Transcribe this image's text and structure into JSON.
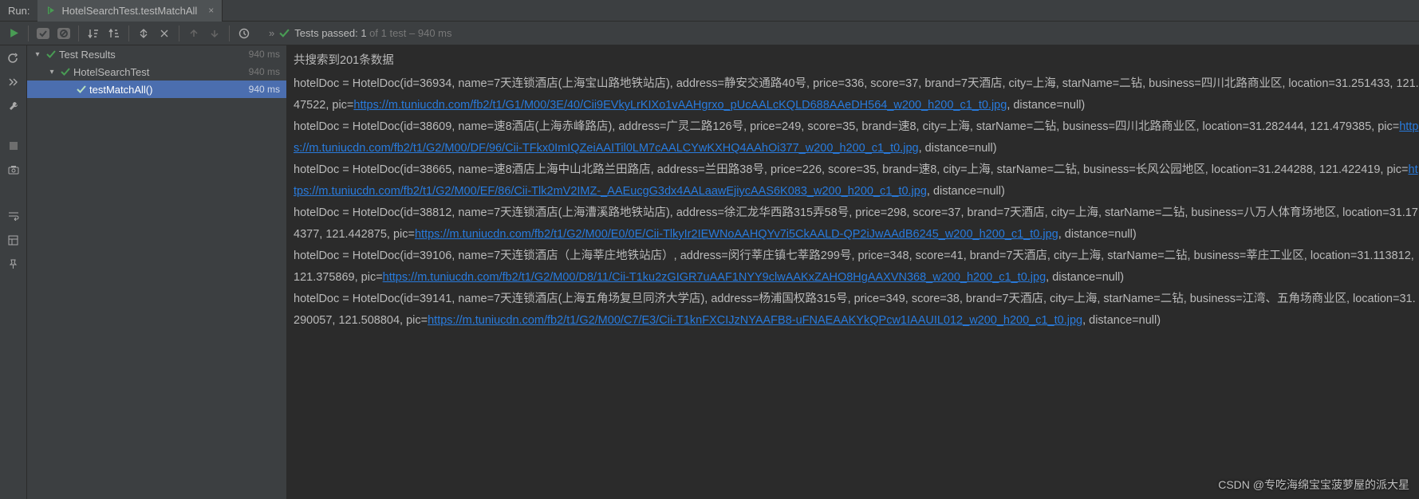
{
  "header": {
    "run_label": "Run:",
    "tab_title": "HotelSearchTest.testMatchAll"
  },
  "status": {
    "passed_prefix": "Tests passed: 1",
    "passed_suffix": " of 1 test – 940 ms"
  },
  "tree": {
    "nodes": [
      {
        "label": "Test Results",
        "time": "940 ms",
        "level": 0,
        "selected": false,
        "arrow": true
      },
      {
        "label": "HotelSearchTest",
        "time": "940 ms",
        "level": 1,
        "selected": false,
        "arrow": true
      },
      {
        "label": "testMatchAll()",
        "time": "940 ms",
        "level": 2,
        "selected": true,
        "arrow": false
      }
    ]
  },
  "console": {
    "summary": "共搜索到201条数据",
    "entries": [
      {
        "pre": "hotelDoc = HotelDoc(id=36934, name=7天连锁酒店(上海宝山路地铁站店), address=静安交通路40号, price=336, score=37, brand=7天酒店, city=上海, starName=二钻, business=四川北路商业区, location=31.251433, 121.47522, pic=",
        "link": "https://m.tuniucdn.com/fb2/t1/G1/M00/3E/40/Cii9EVkyLrKIXo1vAAHgrxo_pUcAALcKQLD688AAeDH564_w200_h200_c1_t0.jpg",
        "post": ", distance=null)"
      },
      {
        "pre": "hotelDoc = HotelDoc(id=38609, name=速8酒店(上海赤峰路店), address=广灵二路126号, price=249, score=35, brand=速8, city=上海, starName=二钻, business=四川北路商业区, location=31.282444, 121.479385, pic=",
        "link": "https://m.tuniucdn.com/fb2/t1/G2/M00/DF/96/Cii-TFkx0ImIQZeiAAITil0LM7cAALCYwKXHQ4AAhOi377_w200_h200_c1_t0.jpg",
        "post": ", distance=null)"
      },
      {
        "pre": "hotelDoc = HotelDoc(id=38665, name=速8酒店上海中山北路兰田路店, address=兰田路38号, price=226, score=35, brand=速8, city=上海, starName=二钻, business=长风公园地区, location=31.244288, 121.422419, pic=",
        "link": "https://m.tuniucdn.com/fb2/t1/G2/M00/EF/86/Cii-Tlk2mV2IMZ-_AAEucgG3dx4AALaawEjiycAAS6K083_w200_h200_c1_t0.jpg",
        "post": ", distance=null)"
      },
      {
        "pre": "hotelDoc = HotelDoc(id=38812, name=7天连锁酒店(上海漕溪路地铁站店), address=徐汇龙华西路315弄58号, price=298, score=37, brand=7天酒店, city=上海, starName=二钻, business=八万人体育场地区, location=31.174377, 121.442875, pic=",
        "link": "https://m.tuniucdn.com/fb2/t1/G2/M00/E0/0E/Cii-TlkyIr2IEWNoAAHQYv7i5CkAALD-QP2iJwAAdB6245_w200_h200_c1_t0.jpg",
        "post": ", distance=null)"
      },
      {
        "pre": "hotelDoc = HotelDoc(id=39106, name=7天连锁酒店（上海莘庄地铁站店）, address=闵行莘庄镇七莘路299号, price=348, score=41, brand=7天酒店, city=上海, starName=二钻, business=莘庄工业区, location=31.113812, 121.375869, pic=",
        "link": "https://m.tuniucdn.com/fb2/t1/G2/M00/D8/11/Cii-T1ku2zGIGR7uAAF1NYY9clwAAKxZAHO8HgAAXVN368_w200_h200_c1_t0.jpg",
        "post": ", distance=null)"
      },
      {
        "pre": "hotelDoc = HotelDoc(id=39141, name=7天连锁酒店(上海五角场复旦同济大学店), address=杨浦国权路315号, price=349, score=38, brand=7天酒店, city=上海, starName=二钻, business=江湾、五角场商业区, location=31.290057, 121.508804, pic=",
        "link": "https://m.tuniucdn.com/fb2/t1/G2/M00/C7/E3/Cii-T1knFXCIJzNYAAFB8-uFNAEAAKYkQPcw1IAAUIL012_w200_h200_c1_t0.jpg",
        "post": ", distance=null)"
      }
    ]
  },
  "watermark": "CSDN @专吃海绵宝宝菠萝屋的派大星",
  "icons": {
    "play": "play-icon",
    "check": "check-icon",
    "stop": "stop-icon",
    "sortdown": "sort-down-icon",
    "sortup": "sort-up-icon",
    "expand": "expand-icon",
    "collapse": "collapse-icon",
    "up": "arrow-up-icon",
    "down": "arrow-down-icon",
    "target": "target-icon",
    "rerun": "rerun-icon",
    "debug": "debug-icon",
    "wrench": "wrench-icon",
    "square": "square-stop-icon",
    "camera": "camera-icon",
    "fold": "fold-icon",
    "layout": "layout-icon",
    "pin": "pin-icon"
  }
}
